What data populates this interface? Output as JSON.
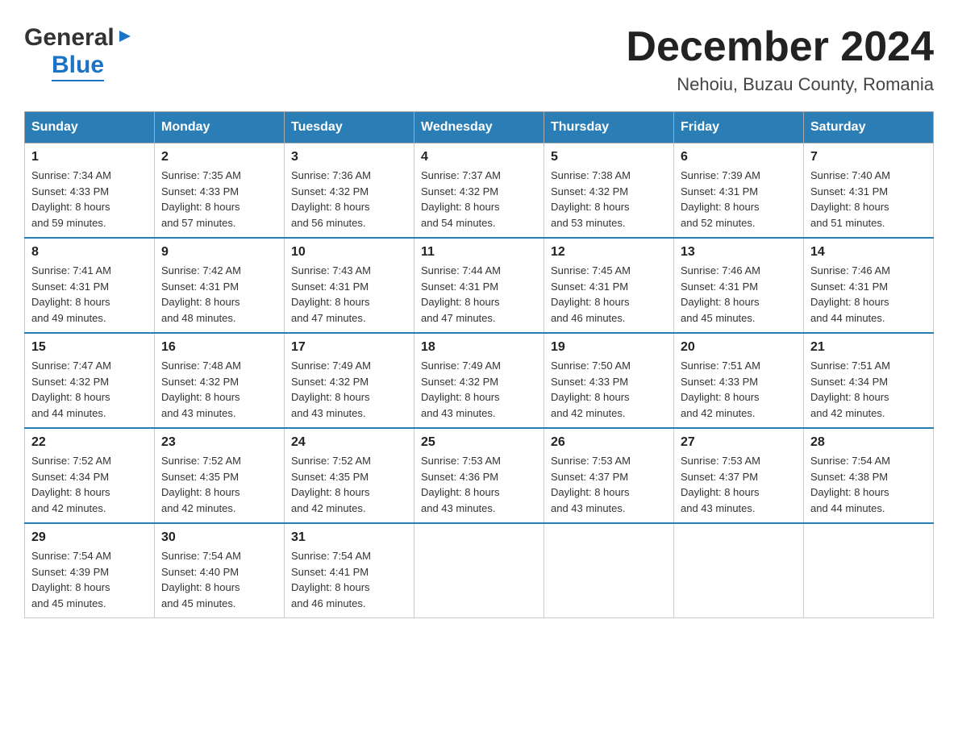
{
  "header": {
    "logo_general": "General",
    "logo_blue": "Blue",
    "month_title": "December 2024",
    "location": "Nehoiu, Buzau County, Romania"
  },
  "days_of_week": [
    "Sunday",
    "Monday",
    "Tuesday",
    "Wednesday",
    "Thursday",
    "Friday",
    "Saturday"
  ],
  "weeks": [
    [
      {
        "day": "1",
        "sunrise": "7:34 AM",
        "sunset": "4:33 PM",
        "daylight": "8 hours and 59 minutes."
      },
      {
        "day": "2",
        "sunrise": "7:35 AM",
        "sunset": "4:33 PM",
        "daylight": "8 hours and 57 minutes."
      },
      {
        "day": "3",
        "sunrise": "7:36 AM",
        "sunset": "4:32 PM",
        "daylight": "8 hours and 56 minutes."
      },
      {
        "day": "4",
        "sunrise": "7:37 AM",
        "sunset": "4:32 PM",
        "daylight": "8 hours and 54 minutes."
      },
      {
        "day": "5",
        "sunrise": "7:38 AM",
        "sunset": "4:32 PM",
        "daylight": "8 hours and 53 minutes."
      },
      {
        "day": "6",
        "sunrise": "7:39 AM",
        "sunset": "4:31 PM",
        "daylight": "8 hours and 52 minutes."
      },
      {
        "day": "7",
        "sunrise": "7:40 AM",
        "sunset": "4:31 PM",
        "daylight": "8 hours and 51 minutes."
      }
    ],
    [
      {
        "day": "8",
        "sunrise": "7:41 AM",
        "sunset": "4:31 PM",
        "daylight": "8 hours and 49 minutes."
      },
      {
        "day": "9",
        "sunrise": "7:42 AM",
        "sunset": "4:31 PM",
        "daylight": "8 hours and 48 minutes."
      },
      {
        "day": "10",
        "sunrise": "7:43 AM",
        "sunset": "4:31 PM",
        "daylight": "8 hours and 47 minutes."
      },
      {
        "day": "11",
        "sunrise": "7:44 AM",
        "sunset": "4:31 PM",
        "daylight": "8 hours and 47 minutes."
      },
      {
        "day": "12",
        "sunrise": "7:45 AM",
        "sunset": "4:31 PM",
        "daylight": "8 hours and 46 minutes."
      },
      {
        "day": "13",
        "sunrise": "7:46 AM",
        "sunset": "4:31 PM",
        "daylight": "8 hours and 45 minutes."
      },
      {
        "day": "14",
        "sunrise": "7:46 AM",
        "sunset": "4:31 PM",
        "daylight": "8 hours and 44 minutes."
      }
    ],
    [
      {
        "day": "15",
        "sunrise": "7:47 AM",
        "sunset": "4:32 PM",
        "daylight": "8 hours and 44 minutes."
      },
      {
        "day": "16",
        "sunrise": "7:48 AM",
        "sunset": "4:32 PM",
        "daylight": "8 hours and 43 minutes."
      },
      {
        "day": "17",
        "sunrise": "7:49 AM",
        "sunset": "4:32 PM",
        "daylight": "8 hours and 43 minutes."
      },
      {
        "day": "18",
        "sunrise": "7:49 AM",
        "sunset": "4:32 PM",
        "daylight": "8 hours and 43 minutes."
      },
      {
        "day": "19",
        "sunrise": "7:50 AM",
        "sunset": "4:33 PM",
        "daylight": "8 hours and 42 minutes."
      },
      {
        "day": "20",
        "sunrise": "7:51 AM",
        "sunset": "4:33 PM",
        "daylight": "8 hours and 42 minutes."
      },
      {
        "day": "21",
        "sunrise": "7:51 AM",
        "sunset": "4:34 PM",
        "daylight": "8 hours and 42 minutes."
      }
    ],
    [
      {
        "day": "22",
        "sunrise": "7:52 AM",
        "sunset": "4:34 PM",
        "daylight": "8 hours and 42 minutes."
      },
      {
        "day": "23",
        "sunrise": "7:52 AM",
        "sunset": "4:35 PM",
        "daylight": "8 hours and 42 minutes."
      },
      {
        "day": "24",
        "sunrise": "7:52 AM",
        "sunset": "4:35 PM",
        "daylight": "8 hours and 42 minutes."
      },
      {
        "day": "25",
        "sunrise": "7:53 AM",
        "sunset": "4:36 PM",
        "daylight": "8 hours and 43 minutes."
      },
      {
        "day": "26",
        "sunrise": "7:53 AM",
        "sunset": "4:37 PM",
        "daylight": "8 hours and 43 minutes."
      },
      {
        "day": "27",
        "sunrise": "7:53 AM",
        "sunset": "4:37 PM",
        "daylight": "8 hours and 43 minutes."
      },
      {
        "day": "28",
        "sunrise": "7:54 AM",
        "sunset": "4:38 PM",
        "daylight": "8 hours and 44 minutes."
      }
    ],
    [
      {
        "day": "29",
        "sunrise": "7:54 AM",
        "sunset": "4:39 PM",
        "daylight": "8 hours and 45 minutes."
      },
      {
        "day": "30",
        "sunrise": "7:54 AM",
        "sunset": "4:40 PM",
        "daylight": "8 hours and 45 minutes."
      },
      {
        "day": "31",
        "sunrise": "7:54 AM",
        "sunset": "4:41 PM",
        "daylight": "8 hours and 46 minutes."
      },
      null,
      null,
      null,
      null
    ]
  ],
  "labels": {
    "sunrise": "Sunrise:",
    "sunset": "Sunset:",
    "daylight": "Daylight:"
  }
}
